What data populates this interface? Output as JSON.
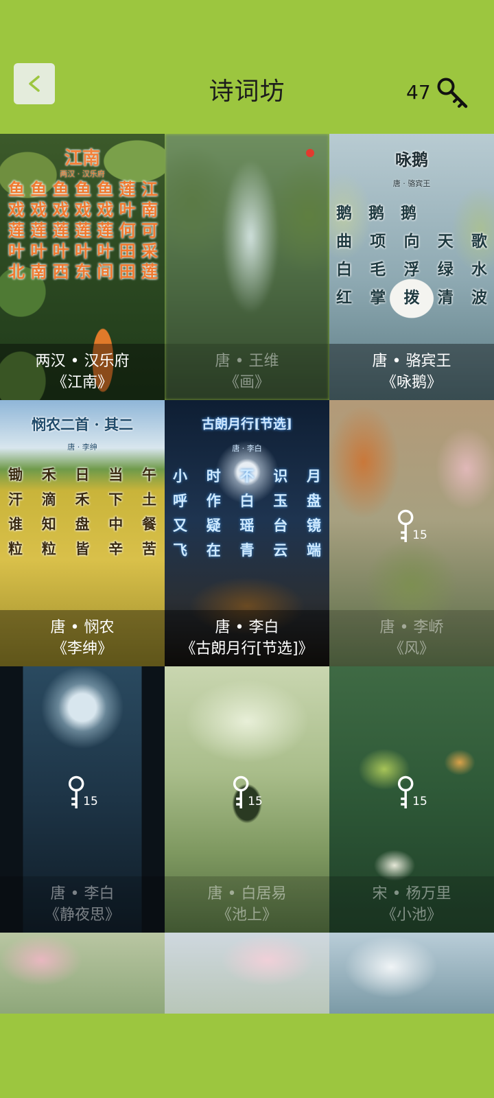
{
  "header": {
    "back_label": "<",
    "title": "诗词坊",
    "key_count": "47"
  },
  "colors": {
    "background": "#9cc63f",
    "accent_red": "#e23a2e"
  },
  "tiles": [
    {
      "dynasty_author": "两汉 • 汉乐府",
      "title": "《江南》",
      "state": "unlocked",
      "poem_title": "江南",
      "poem_sub": "两汉 · 汉乐府",
      "columns": [
        "江南可采莲",
        "莲叶何田田",
        "鱼戏莲叶间",
        "鱼戏莲叶东",
        "鱼戏莲叶西",
        "鱼戏莲叶南",
        "鱼戏莲叶北"
      ]
    },
    {
      "dynasty_author": "唐 • 王维",
      "title": "《画》",
      "state": "new"
    },
    {
      "dynasty_author": "唐 • 骆宾王",
      "title": "《咏鹅》",
      "state": "unlocked",
      "poem_title": "咏鹅",
      "poem_sub": "唐 · 骆宾王",
      "rows": [
        "鹅 鹅 鹅",
        "曲项向天歌",
        "白毛浮绿水",
        "红掌拨清波"
      ]
    },
    {
      "dynasty_author": "唐 • 悯农",
      "title": "《李绅》",
      "state": "unlocked",
      "poem_title": "悯农二首 · 其二",
      "poem_sub": "唐 · 李绅",
      "rows": [
        "锄禾日当午",
        "汗滴禾下土",
        "谁知盘中餐",
        "粒粒皆辛苦"
      ]
    },
    {
      "dynasty_author": "唐 • 李白",
      "title": "《古朗月行[节选]》",
      "state": "unlocked",
      "poem_title": "古朗月行[节选]",
      "poem_sub": "唐 · 李白",
      "rows": [
        "小时不识月",
        "呼作白玉盘",
        "又疑瑶台镜",
        "飞在青云端"
      ]
    },
    {
      "dynasty_author": "唐 • 李峤",
      "title": "《风》",
      "state": "locked",
      "cost": "15"
    },
    {
      "dynasty_author": "唐 • 李白",
      "title": "《静夜思》",
      "state": "locked",
      "cost": "15"
    },
    {
      "dynasty_author": "唐 • 白居易",
      "title": "《池上》",
      "state": "locked",
      "cost": "15"
    },
    {
      "dynasty_author": "宋 • 杨万里",
      "title": "《小池》",
      "state": "locked",
      "cost": "15"
    }
  ]
}
